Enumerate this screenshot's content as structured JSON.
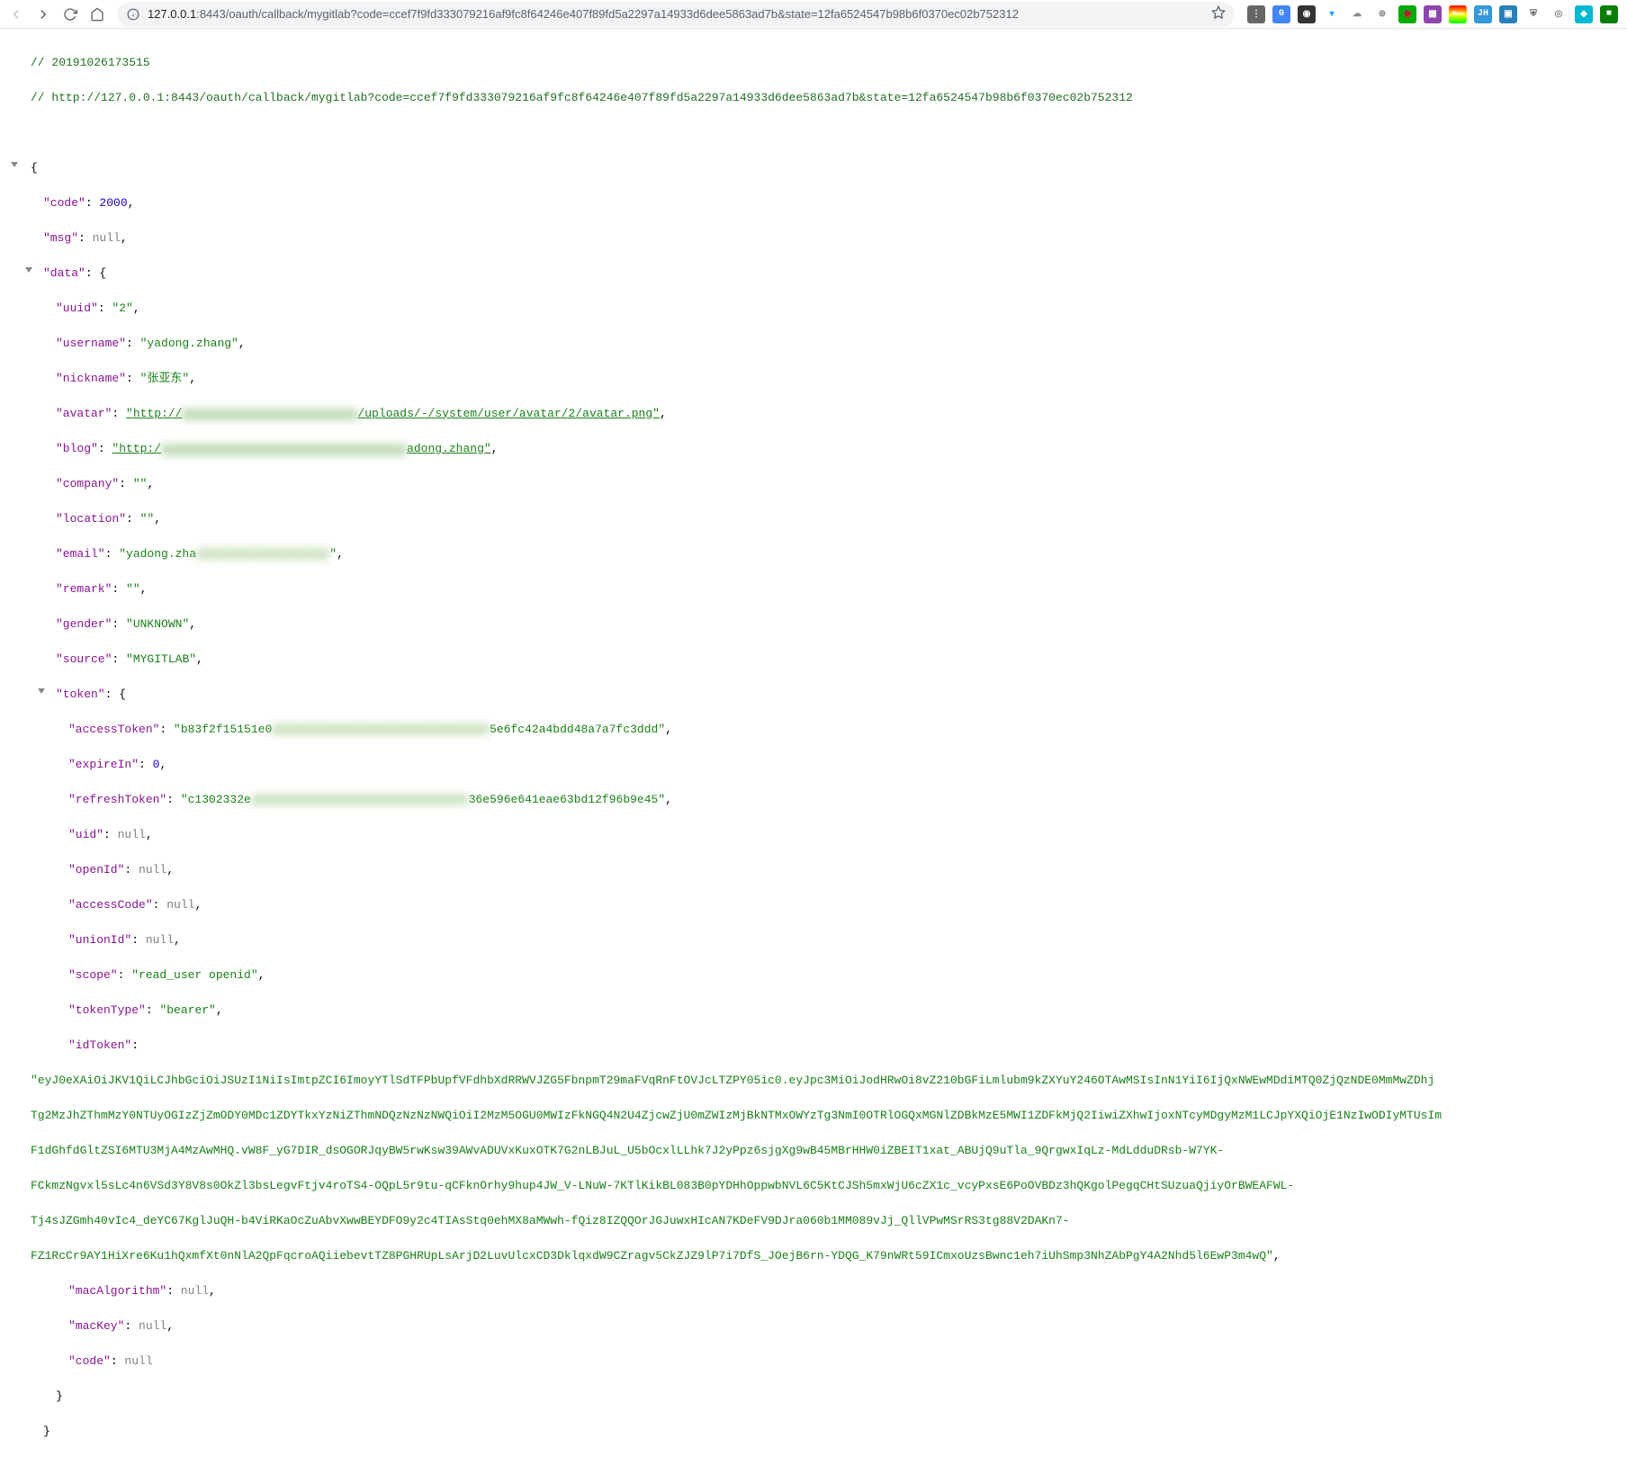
{
  "browser": {
    "url_host": "127.0.0.1",
    "url_port": ":8443",
    "url_path": "/oauth/callback/mygitlab?code=ccef7f9fd333079216af9fc8f64246e407f89fd5a2297a14933d6dee5863ad7b&state=12fa6524547b98b6f0370ec02b752312"
  },
  "comments": {
    "ts": "// 20191026173515",
    "url": "// http://127.0.0.1:8443/oauth/callback/mygitlab?code=ccef7f9fd333079216af9fc8f64246e407f89fd5a2297a14933d6dee5863ad7b&state=12fa6524547b98b6f0370ec02b752312"
  },
  "json": {
    "code": 2000,
    "msg": "null",
    "data": {
      "uuid": "\"2\"",
      "username": "\"yadong.zhang\"",
      "nickname": "\"张亚东\"",
      "avatar_pre": "\"http://",
      "avatar_hidden": "xxxxxxxxxxxxxxxxxxxxxxxxx",
      "avatar_post": "/uploads/-/system/user/avatar/2/avatar.png\"",
      "blog_pre": "\"http:/",
      "blog_hidden": "xxxxxxxxxxxxxxxxxxxxxxxxxxxxxxxxxxx",
      "blog_post": "adong.zhang\"",
      "company": "\"\"",
      "location": "\"\"",
      "email_pre": "\"yadong.zha",
      "email_hidden": "xxxxxxxxxxxxxxxxxxx",
      "email_post": "\"",
      "remark": "\"\"",
      "gender": "\"UNKNOWN\"",
      "source": "\"MYGITLAB\"",
      "token": {
        "accessToken_pre": "\"b83f2f15151e0",
        "accessToken_hidden": "xxxxxxxxxxxxxxxxxxxxxxxxxxxxxxx",
        "accessToken_post": "5e6fc42a4bdd48a7a7fc3ddd\"",
        "expireIn": 0,
        "refreshToken_pre": "\"c1302332e",
        "refreshToken_hidden": "xxxxxxxxxxxxxxxxxxxxxxxxxxxxxxx",
        "refreshToken_post": "36e596e641eae63bd12f96b9e45\"",
        "uid": "null",
        "openId": "null",
        "accessCode": "null",
        "unionId": "null",
        "scope": "\"read_user openid\"",
        "tokenType": "\"bearer\"",
        "idToken_l1": "\"eyJ0eXAiOiJKV1QiLCJhbGciOiJSUzI1NiIsImtpZCI6ImoyYTlSdTFPbUpfVFdhbXdRRWVJZG5FbnpmT29maFVqRnFtOVJcLTZPY05ic0.eyJpc3MiOiJodHRwOi8vZ210bGFiLmlubm9kZXYuY246OTAwMSIsInN1YiI6IjQxNWEwMDdiMTQ0ZjQzNDE0MmMwZDhj",
        "idToken_l2": "Tg2MzJhZThmMzY0NTUyOGIzZjZmODY0MDc1ZDYTkxYzNiZThmNDQzNzNzNWQiOiI2MzM5OGU0MWIzFkNGQ4N2U4ZjcwZjU0mZWIzMjBkNTMxOWYzTg3NmI0OTRlOGQxMGNlZDBkMzE5MWI1ZDFkMjQ2IiwiZXhwIjoxNTcyMDgyMzM1LCJpYXQiOjE1NzIwODIyMTUsIm",
        "idToken_l3": "F1dGhfdGltZSI6MTU3MjA4MzAwMHQ.vW8F_yG7DIR_dsOGORJqyBW5rwKsw39AWvADUVxKuxOTK7G2nLBJuL_U5bOcxlLLhk7J2yPpz6sjgXg9wB45MBrHHW0iZBEIT1xat_ABUjQ9uTla_9QrgwxIqLz-MdLdduDRsb-W7YK-",
        "idToken_l4": "FCkmzNgvxl5sLc4n6VSd3Y8V8s0OkZl3bsLegvFtjv4roTS4-OQpL5r9tu-qCFknOrhy9hup4JW_V-LNuW-7KTlKikBL083B0pYDHhOppwbNVL6C5KtCJSh5mxWjU6cZX1c_vcyPxsE6PoOVBDz3hQKgolPegqCHtSUzuaQjiyOrBWEAFWL-",
        "idToken_l5": "Tj4sJZGmh40vIc4_deYC67KglJuQH-b4ViRKaOcZuAbvXwwBEYDFO9y2c4TIAsStq0ehMX8aMWwh-fQiz8IZQQOrJGJuwxHIcAN7KDeFV9DJra060b1MM089vJj_QllVPwMSrRS3tg88V2DAKn7-",
        "idToken_l6": "FZ1RcCr9AY1HiXre6Ku1hQxmfXt0nNlA2QpFqcroAQiiebevtTZ8PGHRUpLsArjD2LuvUlcxCD3DklqxdW9CZragv5CkZJZ9lP7i7DfS_JOejB6rn-YDQG_K79nWRt59ICmxoUzsBwnc1eh7iUhSmp3NhZAbPgY4A2Nhd5l6EwP3m4wQ\"",
        "macAlgorithm": "null",
        "macKey": "null",
        "code": "null"
      }
    }
  }
}
